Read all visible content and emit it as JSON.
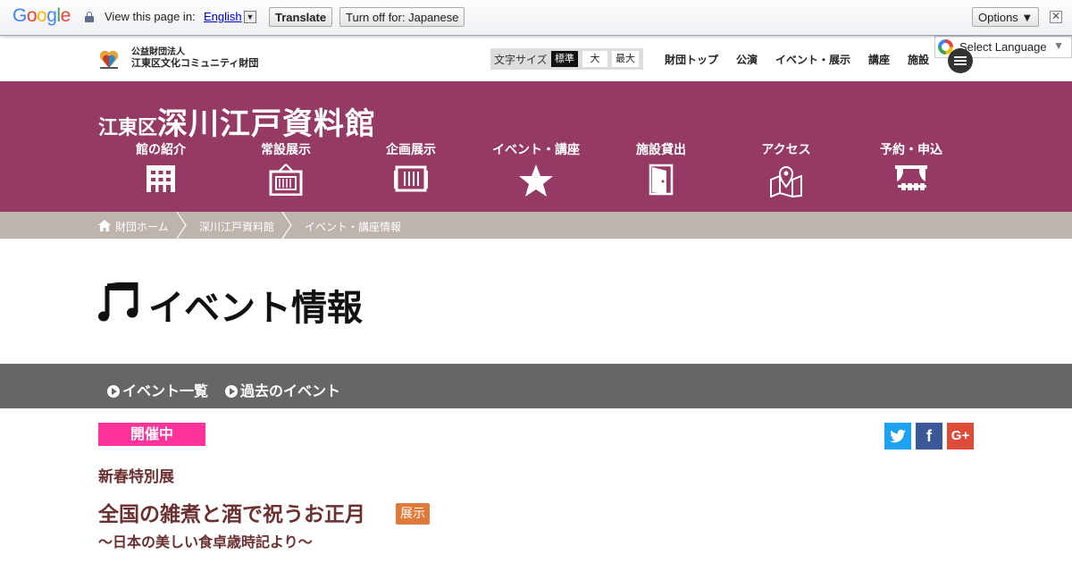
{
  "translate_bar": {
    "logo": "Google",
    "view_text": "View this page in:",
    "language": "English",
    "translate_label": "Translate",
    "turn_off_label": "Turn off for: Japanese",
    "options_label": "Options ▼",
    "close_label": "✕"
  },
  "header": {
    "foundation_line1": "公益財団法人",
    "foundation_line2": "江東区文化コミュニティ財団",
    "font_size_label": "文字サイズ",
    "font_size_options": [
      "標準",
      "大",
      "最大"
    ],
    "top_nav": [
      "財団トップ",
      "公演",
      "イベント・展示",
      "講座",
      "施設"
    ],
    "select_language": "Select Language"
  },
  "banner": {
    "title_small": "江東区",
    "title_big": "深川江戸資料館",
    "nav": [
      {
        "label": "館の紹介",
        "icon": "building-icon"
      },
      {
        "label": "常設展示",
        "icon": "exhibit-frame-icon"
      },
      {
        "label": "企画展示",
        "icon": "special-exhibit-icon"
      },
      {
        "label": "イベント・講座",
        "icon": "star-icon"
      },
      {
        "label": "施設貸出",
        "icon": "door-icon"
      },
      {
        "label": "アクセス",
        "icon": "map-pin-icon"
      },
      {
        "label": "予約・申込",
        "icon": "theater-icon"
      }
    ]
  },
  "breadcrumb": [
    "財団ホーム",
    "深川江戸資料館",
    "イベント・講座情報"
  ],
  "page_heading": "イベント情報",
  "sub_nav": [
    "イベント一覧",
    "過去のイベント"
  ],
  "event": {
    "status": "開催中",
    "category": "新春特別展",
    "title": "全国の雑煮と酒で祝うお正月",
    "tag": "展示",
    "subtitle": "～日本の美しい食卓歳時記より～"
  },
  "share": {
    "twitter": "t",
    "facebook": "f",
    "google_plus": "G+"
  },
  "colors": {
    "banner": "#953a64",
    "breadcrumb": "#bfb3ad",
    "subnav": "#666666",
    "status": "#ff3399",
    "tag": "#e07a3a",
    "title": "#6b3030"
  }
}
